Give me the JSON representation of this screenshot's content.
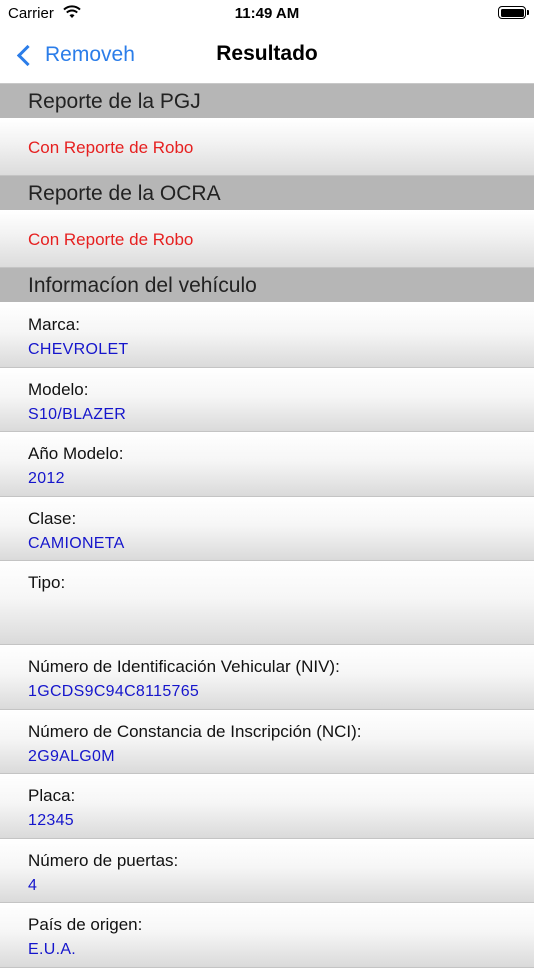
{
  "status_bar": {
    "carrier": "Carrier",
    "time": "11:49 AM"
  },
  "nav": {
    "back_label": "Removeh",
    "title": "Resultado"
  },
  "sections": {
    "pgj": {
      "header": "Reporte de la PGJ",
      "value": "Con Reporte de Robo"
    },
    "ocra": {
      "header": "Reporte de la OCRA",
      "value": "Con Reporte de Robo"
    },
    "vehicle": {
      "header": "Informacíon del vehículo",
      "rows": [
        {
          "label": "Marca:",
          "value": "CHEVROLET"
        },
        {
          "label": "Modelo:",
          "value": "S10/BLAZER"
        },
        {
          "label": "Año Modelo:",
          "value": "2012"
        },
        {
          "label": "Clase:",
          "value": "CAMIONETA"
        },
        {
          "label": "Tipo:",
          "value": ""
        },
        {
          "label": "Número de Identificación Vehicular (NIV):",
          "value": "1GCDS9C94C8115765"
        },
        {
          "label": "Número de Constancia de Inscripción (NCI):",
          "value": "2G9ALG0M"
        },
        {
          "label": "Placa:",
          "value": "12345"
        },
        {
          "label": "Número de puertas:",
          "value": "4"
        },
        {
          "label": "País de origen:",
          "value": "E.U.A."
        }
      ]
    }
  },
  "colors": {
    "accent": "#2b7de9",
    "report_text": "#e62020",
    "value_text": "#1515cc",
    "section_header_bg": "#b6b6b6"
  }
}
